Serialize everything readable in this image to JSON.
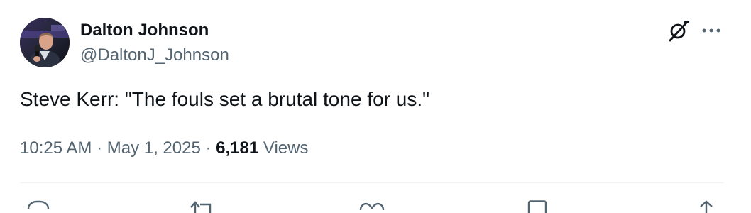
{
  "author": {
    "name": "Dalton Johnson",
    "handle": "@DaltonJ_Johnson"
  },
  "tweet": {
    "text": "Steve Kerr: \"The fouls set a brutal tone for us.\""
  },
  "meta": {
    "time": "10:25 AM",
    "separator1": " · ",
    "date": "May 1, 2025",
    "separator2": " · ",
    "views_count": "6,181",
    "views_label": " Views"
  },
  "icons": {
    "grok": "grok-icon",
    "more": "more-icon",
    "reply": "reply-icon",
    "retweet": "retweet-icon",
    "like": "like-icon",
    "bookmark": "bookmark-icon",
    "share": "share-icon"
  },
  "colors": {
    "text_primary": "#0f1419",
    "text_secondary": "#536471",
    "divider": "#eff3f4"
  }
}
